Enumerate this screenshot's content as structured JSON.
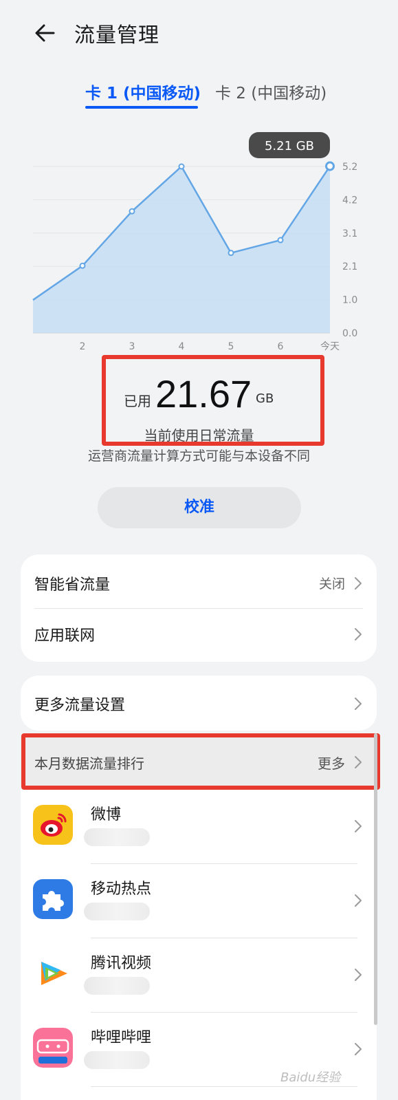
{
  "header": {
    "title": "流量管理",
    "back_icon": "arrow-left-icon"
  },
  "tabs": [
    {
      "label": "卡 1 (中国移动)",
      "selected": true
    },
    {
      "label": "卡 2 (中国移动)",
      "selected": false
    }
  ],
  "chart_data": {
    "type": "area",
    "title": "",
    "xlabel": "",
    "ylabel": "",
    "x_ticks": [
      "2",
      "3",
      "4",
      "5",
      "6",
      "今天"
    ],
    "y_ticks": [
      "0.0",
      "1.0",
      "2.1",
      "3.1",
      "4.2",
      "5.2"
    ],
    "ylim": [
      0,
      5.2
    ],
    "series": [
      {
        "x": [
          1,
          2,
          3,
          4,
          5,
          6,
          7
        ],
        "values": [
          1.03,
          2.1,
          3.8,
          5.2,
          2.5,
          2.9,
          5.21
        ]
      }
    ],
    "tooltip": "5.21 GB",
    "grid": true,
    "colors": {
      "line": "#63a6e6",
      "fill": "#c7ddf5"
    }
  },
  "usage": {
    "used_label": "已用",
    "used_value": "21.67",
    "used_unit": "GB",
    "description": "当前使用日常流量"
  },
  "carrier_note": "运营商流量计算方式可能与本设备不同",
  "calibrate_label": "校准",
  "settings": [
    {
      "label": "智能省流量",
      "value": "关闭"
    },
    {
      "label": "应用联网",
      "value": ""
    }
  ],
  "more_settings": {
    "label": "更多流量设置"
  },
  "ranking": {
    "title": "本月数据流量排行",
    "more_label": "更多",
    "apps": [
      {
        "name": "微博",
        "usage": "",
        "icon": "weibo-icon"
      },
      {
        "name": "移动热点",
        "usage": "",
        "icon": "hotspot-puzzle-icon"
      },
      {
        "name": "腾讯视频",
        "usage": "",
        "icon": "tencent-video-icon"
      },
      {
        "name": "哔哩哔哩",
        "usage": "",
        "icon": "bilibili-icon"
      }
    ]
  },
  "watermark": "Baidu经验",
  "accent_color": "#0a59f7",
  "highlight_color": "#e8392f"
}
